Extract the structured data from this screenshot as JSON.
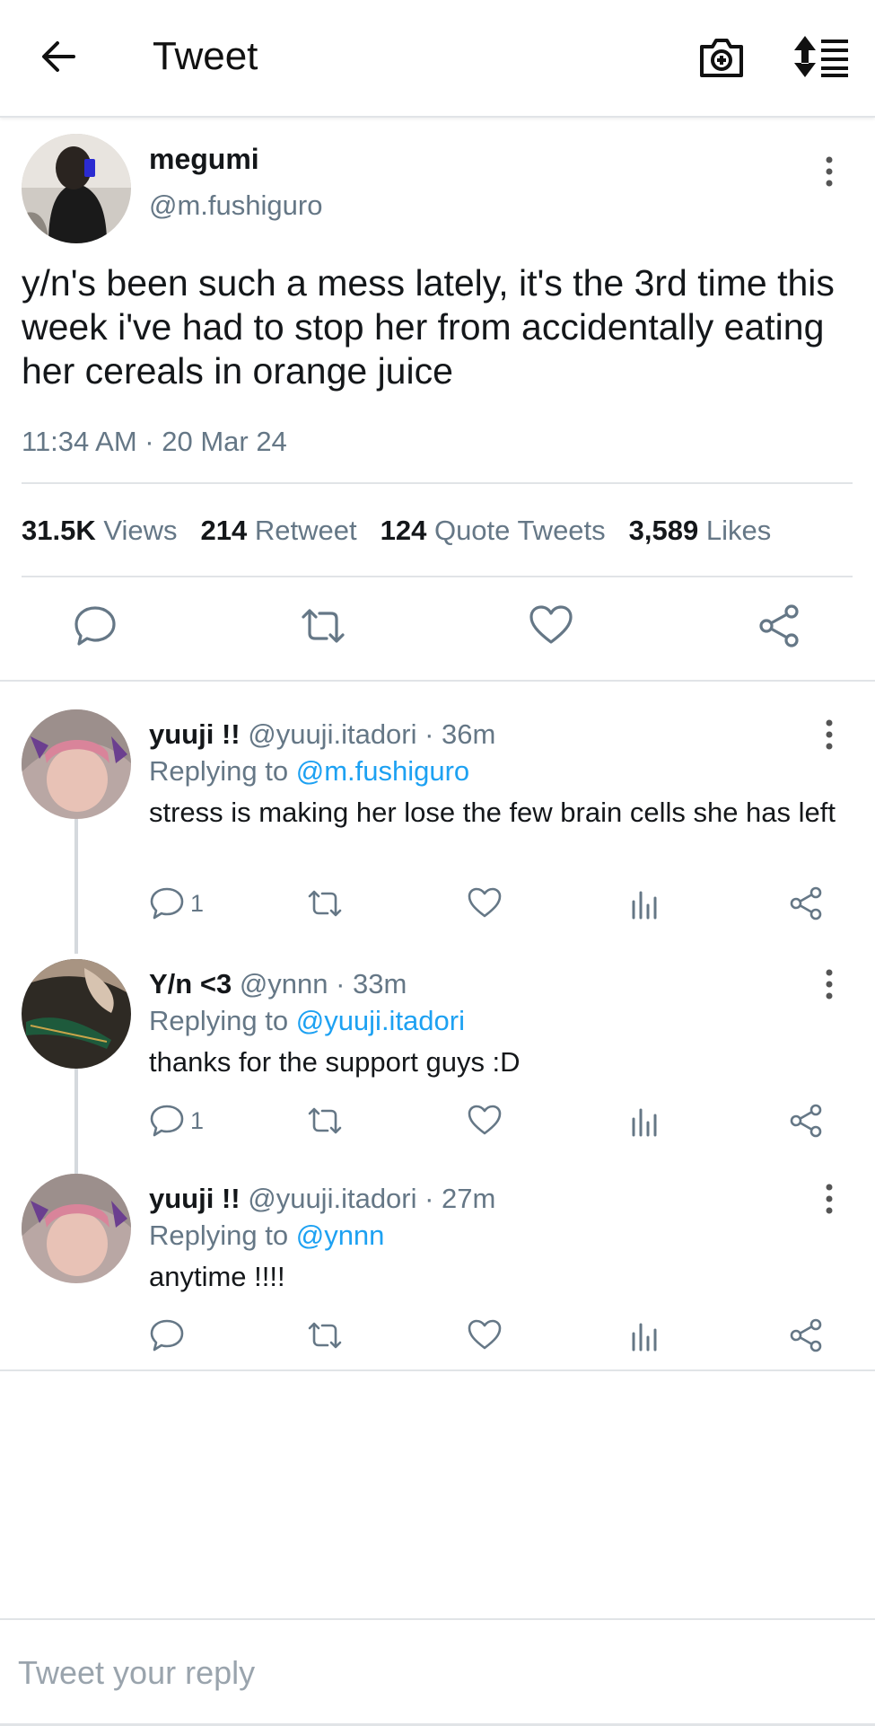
{
  "header": {
    "title": "Tweet"
  },
  "main_tweet": {
    "name": "megumi",
    "handle": "@m.fushiguro",
    "text": "y/n's been such a mess lately, it's the 3rd time this week i've had to stop her from accidentally eating her cereals in orange juice",
    "timestamp": "11:34 AM · 20 Mar 24",
    "stats": {
      "views_count": "31.5K",
      "views_label": "Views",
      "retweets_count": "214",
      "retweets_label": "Retweet",
      "quotes_count": "124",
      "quotes_label": "Quote Tweets",
      "likes_count": "3,589",
      "likes_label": "Likes"
    }
  },
  "replies": [
    {
      "name": "yuuji !!",
      "meta": "@yuuji.itadori · 36m",
      "replying_prefix": "Replying to",
      "replying_to": "@m.fushiguro",
      "text": "stress is making her lose the few brain cells she has left",
      "reply_count": "1"
    },
    {
      "name": "Y/n <3",
      "meta": "@ynnn · 33m",
      "replying_prefix": "Replying to",
      "replying_to": "@yuuji.itadori",
      "text": "thanks for the support guys :D",
      "reply_count": "1"
    },
    {
      "name": "yuuji !!",
      "meta": "@yuuji.itadori · 27m",
      "replying_prefix": "Replying to",
      "replying_to": "@ynnn",
      "text": "anytime !!!!",
      "reply_count": ""
    }
  ],
  "compose": {
    "placeholder": "Tweet your reply"
  },
  "colors": {
    "link": "#1da1f2",
    "secondary_text": "#657786",
    "divider": "#e1e4e7"
  }
}
